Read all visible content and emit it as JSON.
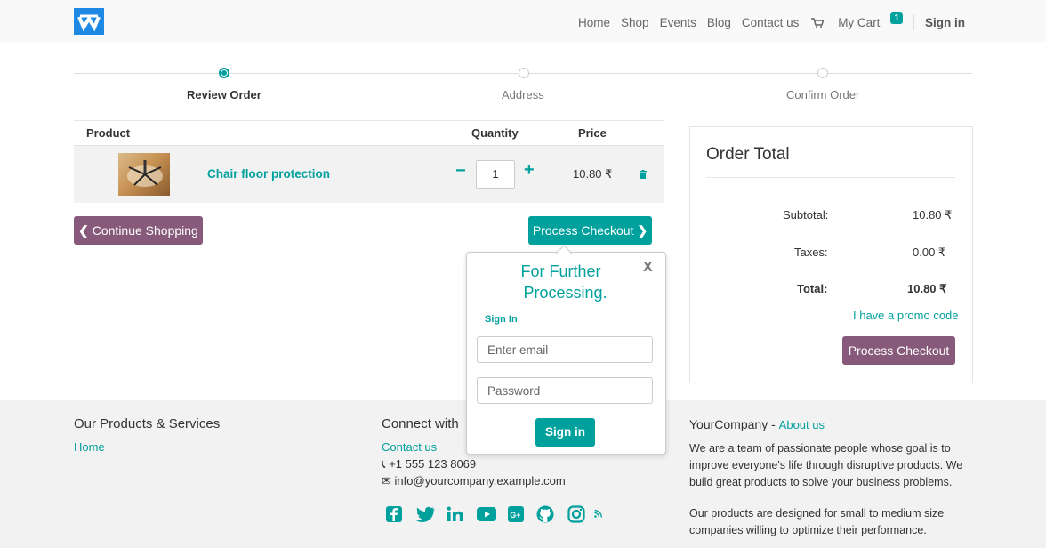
{
  "nav": {
    "items": [
      "Home",
      "Shop",
      "Events",
      "Blog",
      "Contact us"
    ],
    "cart_label": "My Cart",
    "cart_count": "1",
    "signin": "Sign in"
  },
  "wizard": {
    "steps": [
      "Review Order",
      "Address",
      "Confirm Order"
    ],
    "active_index": 0
  },
  "table": {
    "headers": {
      "product": "Product",
      "quantity": "Quantity",
      "price": "Price"
    },
    "row": {
      "name": "Chair floor protection",
      "quantity": "1",
      "price": "10.80 ₹"
    }
  },
  "buttons": {
    "continue": "Continue Shopping",
    "checkout": "Process Checkout",
    "checkout_panel": "Process Checkout"
  },
  "order_total": {
    "title": "Order Total",
    "subtotal_label": "Subtotal:",
    "subtotal": "10.80 ₹",
    "taxes_label": "Taxes:",
    "taxes": "0.00 ₹",
    "total_label": "Total:",
    "total": "10.80 ₹",
    "promo": "I have a promo code"
  },
  "popover": {
    "title_line1": "For Further",
    "title_line2": "Processing.",
    "close": "X",
    "section": "Sign In",
    "email_placeholder": "Enter email",
    "password_placeholder": "Password",
    "submit": "Sign in"
  },
  "footer": {
    "col1_title": "Our Products & Services",
    "col1_link": "Home",
    "col2_title": "Connect with",
    "col2_link": "Contact us",
    "phone": "+1 555 123 8069",
    "email": "info@yourcompany.example.com",
    "col3_company": "YourCompany",
    "col3_about": "About us",
    "col3_p1_l1": "We are a team of passionate people whose goal is to",
    "col3_p1_l2": "improve everyone's life through disruptive products. We",
    "col3_p1_l3": "build great products to solve your business problems.",
    "col3_p2_l1": "Our products are designed for small to medium size",
    "col3_p2_l2": "companies willing to optimize their performance."
  },
  "colors": {
    "accent": "#00A09D",
    "secondary": "#875A7B",
    "logo": "#1e88e5"
  }
}
